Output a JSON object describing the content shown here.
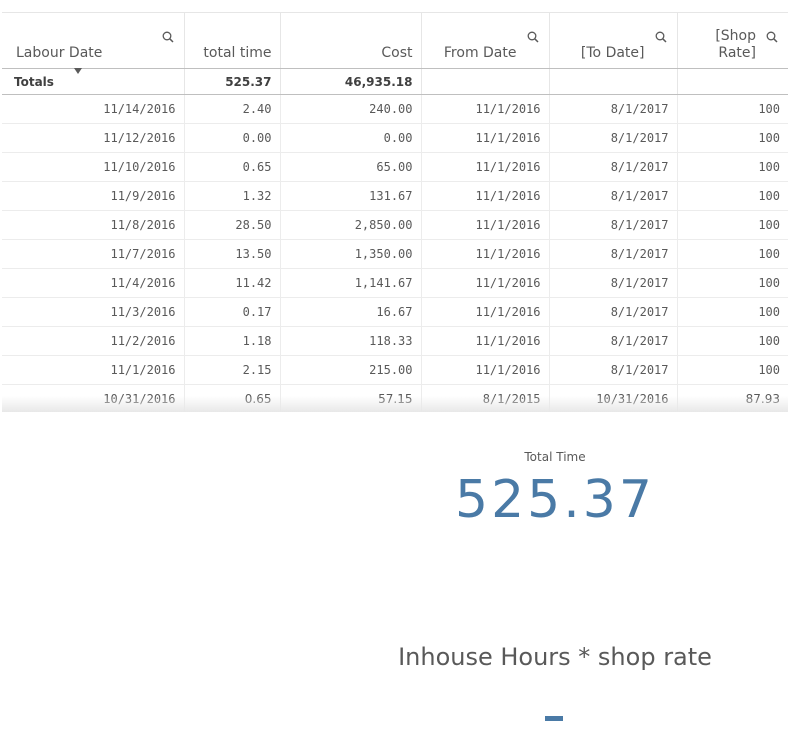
{
  "table": {
    "columns": [
      {
        "label": "Labour Date",
        "searchable": true
      },
      {
        "label": "total time",
        "searchable": false
      },
      {
        "label": "Cost",
        "searchable": false
      },
      {
        "label": "From Date",
        "searchable": true
      },
      {
        "label": "[To Date]",
        "searchable": true
      },
      {
        "label": "[Shop Rate]",
        "searchable": true
      }
    ],
    "totals": {
      "label": "Totals",
      "total_time": "525.37",
      "cost": "46,935.18",
      "from_date": "",
      "to_date": "",
      "shop_rate": ""
    },
    "rows": [
      {
        "labour_date": "11/14/2016",
        "total_time": "2.40",
        "cost": "240.00",
        "from_date": "11/1/2016",
        "to_date": "8/1/2017",
        "shop_rate": "100"
      },
      {
        "labour_date": "11/12/2016",
        "total_time": "0.00",
        "cost": "0.00",
        "from_date": "11/1/2016",
        "to_date": "8/1/2017",
        "shop_rate": "100"
      },
      {
        "labour_date": "11/10/2016",
        "total_time": "0.65",
        "cost": "65.00",
        "from_date": "11/1/2016",
        "to_date": "8/1/2017",
        "shop_rate": "100"
      },
      {
        "labour_date": "11/9/2016",
        "total_time": "1.32",
        "cost": "131.67",
        "from_date": "11/1/2016",
        "to_date": "8/1/2017",
        "shop_rate": "100"
      },
      {
        "labour_date": "11/8/2016",
        "total_time": "28.50",
        "cost": "2,850.00",
        "from_date": "11/1/2016",
        "to_date": "8/1/2017",
        "shop_rate": "100"
      },
      {
        "labour_date": "11/7/2016",
        "total_time": "13.50",
        "cost": "1,350.00",
        "from_date": "11/1/2016",
        "to_date": "8/1/2017",
        "shop_rate": "100"
      },
      {
        "labour_date": "11/4/2016",
        "total_time": "11.42",
        "cost": "1,141.67",
        "from_date": "11/1/2016",
        "to_date": "8/1/2017",
        "shop_rate": "100"
      },
      {
        "labour_date": "11/3/2016",
        "total_time": "0.17",
        "cost": "16.67",
        "from_date": "11/1/2016",
        "to_date": "8/1/2017",
        "shop_rate": "100"
      },
      {
        "labour_date": "11/2/2016",
        "total_time": "1.18",
        "cost": "118.33",
        "from_date": "11/1/2016",
        "to_date": "8/1/2017",
        "shop_rate": "100"
      },
      {
        "labour_date": "11/1/2016",
        "total_time": "2.15",
        "cost": "215.00",
        "from_date": "11/1/2016",
        "to_date": "8/1/2017",
        "shop_rate": "100"
      },
      {
        "labour_date": "10/31/2016",
        "total_time": "0.65",
        "cost": "57.15",
        "from_date": "8/1/2015",
        "to_date": "10/31/2016",
        "shop_rate": "87.93"
      }
    ],
    "sort_indicator_icon": "caret-down-icon",
    "search_icon": "search-icon"
  },
  "kpi_total_time": {
    "label": "Total Time",
    "value": "525.37",
    "color": "#4a7aa6"
  },
  "kpi_inhouse": {
    "title": "Inhouse Hours * shop rate",
    "value": "-",
    "color": "#4a7aa6"
  }
}
